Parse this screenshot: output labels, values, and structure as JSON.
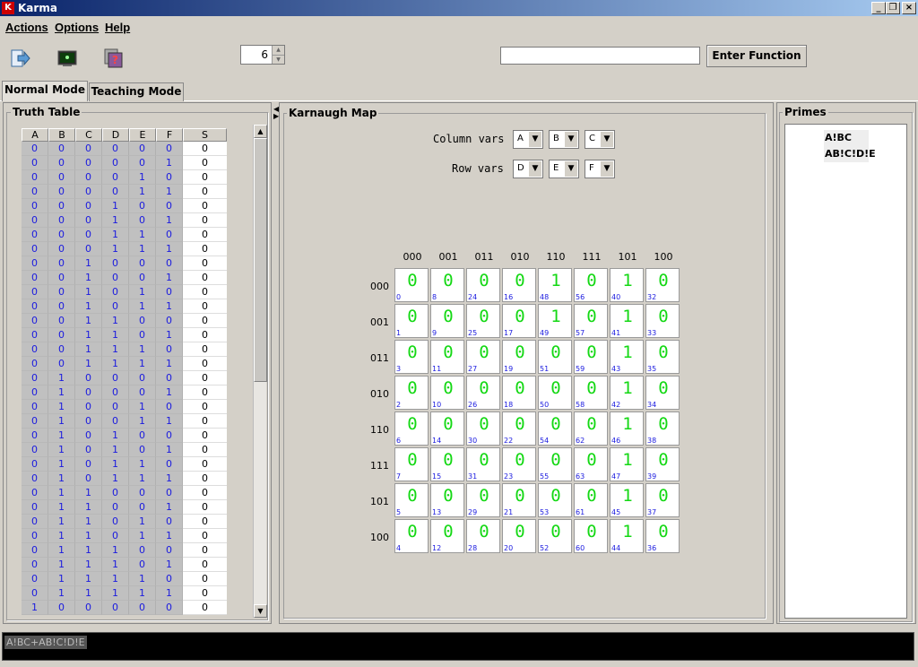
{
  "window": {
    "title": "Karma"
  },
  "menu": [
    "Actions",
    "Options",
    "Help"
  ],
  "toolbar": {
    "variable_count": "6",
    "function_input": "",
    "enter_button": "Enter Function"
  },
  "tabs": [
    "Normal Mode",
    "Teaching Mode"
  ],
  "truth_table": {
    "title": "Truth Table",
    "columns": [
      "A",
      "B",
      "C",
      "D",
      "E",
      "F",
      "S"
    ],
    "rows": [
      [
        "0",
        "0",
        "0",
        "0",
        "0",
        "0",
        "0"
      ],
      [
        "0",
        "0",
        "0",
        "0",
        "0",
        "1",
        "0"
      ],
      [
        "0",
        "0",
        "0",
        "0",
        "1",
        "0",
        "0"
      ],
      [
        "0",
        "0",
        "0",
        "0",
        "1",
        "1",
        "0"
      ],
      [
        "0",
        "0",
        "0",
        "1",
        "0",
        "0",
        "0"
      ],
      [
        "0",
        "0",
        "0",
        "1",
        "0",
        "1",
        "0"
      ],
      [
        "0",
        "0",
        "0",
        "1",
        "1",
        "0",
        "0"
      ],
      [
        "0",
        "0",
        "0",
        "1",
        "1",
        "1",
        "0"
      ],
      [
        "0",
        "0",
        "1",
        "0",
        "0",
        "0",
        "0"
      ],
      [
        "0",
        "0",
        "1",
        "0",
        "0",
        "1",
        "0"
      ],
      [
        "0",
        "0",
        "1",
        "0",
        "1",
        "0",
        "0"
      ],
      [
        "0",
        "0",
        "1",
        "0",
        "1",
        "1",
        "0"
      ],
      [
        "0",
        "0",
        "1",
        "1",
        "0",
        "0",
        "0"
      ],
      [
        "0",
        "0",
        "1",
        "1",
        "0",
        "1",
        "0"
      ],
      [
        "0",
        "0",
        "1",
        "1",
        "1",
        "0",
        "0"
      ],
      [
        "0",
        "0",
        "1",
        "1",
        "1",
        "1",
        "0"
      ],
      [
        "0",
        "1",
        "0",
        "0",
        "0",
        "0",
        "0"
      ],
      [
        "0",
        "1",
        "0",
        "0",
        "0",
        "1",
        "0"
      ],
      [
        "0",
        "1",
        "0",
        "0",
        "1",
        "0",
        "0"
      ],
      [
        "0",
        "1",
        "0",
        "0",
        "1",
        "1",
        "0"
      ],
      [
        "0",
        "1",
        "0",
        "1",
        "0",
        "0",
        "0"
      ],
      [
        "0",
        "1",
        "0",
        "1",
        "0",
        "1",
        "0"
      ],
      [
        "0",
        "1",
        "0",
        "1",
        "1",
        "0",
        "0"
      ],
      [
        "0",
        "1",
        "0",
        "1",
        "1",
        "1",
        "0"
      ],
      [
        "0",
        "1",
        "1",
        "0",
        "0",
        "0",
        "0"
      ],
      [
        "0",
        "1",
        "1",
        "0",
        "0",
        "1",
        "0"
      ],
      [
        "0",
        "1",
        "1",
        "0",
        "1",
        "0",
        "0"
      ],
      [
        "0",
        "1",
        "1",
        "0",
        "1",
        "1",
        "0"
      ],
      [
        "0",
        "1",
        "1",
        "1",
        "0",
        "0",
        "0"
      ],
      [
        "0",
        "1",
        "1",
        "1",
        "0",
        "1",
        "0"
      ],
      [
        "0",
        "1",
        "1",
        "1",
        "1",
        "0",
        "0"
      ],
      [
        "0",
        "1",
        "1",
        "1",
        "1",
        "1",
        "0"
      ],
      [
        "1",
        "0",
        "0",
        "0",
        "0",
        "0",
        "0"
      ]
    ]
  },
  "karnaugh": {
    "title": "Karnaugh Map",
    "column_vars_label": "Column vars",
    "row_vars_label": "Row vars",
    "column_vars": [
      "A",
      "B",
      "C"
    ],
    "row_vars": [
      "D",
      "E",
      "F"
    ],
    "col_headers": [
      "000",
      "001",
      "011",
      "010",
      "110",
      "111",
      "101",
      "100"
    ],
    "row_headers": [
      "000",
      "001",
      "011",
      "010",
      "110",
      "111",
      "101",
      "100"
    ],
    "values": [
      [
        "0",
        "0",
        "0",
        "0",
        "1",
        "0",
        "1",
        "0"
      ],
      [
        "0",
        "0",
        "0",
        "0",
        "1",
        "0",
        "1",
        "0"
      ],
      [
        "0",
        "0",
        "0",
        "0",
        "0",
        "0",
        "1",
        "0"
      ],
      [
        "0",
        "0",
        "0",
        "0",
        "0",
        "0",
        "1",
        "0"
      ],
      [
        "0",
        "0",
        "0",
        "0",
        "0",
        "0",
        "1",
        "0"
      ],
      [
        "0",
        "0",
        "0",
        "0",
        "0",
        "0",
        "1",
        "0"
      ],
      [
        "0",
        "0",
        "0",
        "0",
        "0",
        "0",
        "1",
        "0"
      ],
      [
        "0",
        "0",
        "0",
        "0",
        "0",
        "0",
        "1",
        "0"
      ]
    ],
    "indices": [
      [
        "0",
        "8",
        "24",
        "16",
        "48",
        "56",
        "40",
        "32"
      ],
      [
        "1",
        "9",
        "25",
        "17",
        "49",
        "57",
        "41",
        "33"
      ],
      [
        "3",
        "11",
        "27",
        "19",
        "51",
        "59",
        "43",
        "35"
      ],
      [
        "2",
        "10",
        "26",
        "18",
        "50",
        "58",
        "42",
        "34"
      ],
      [
        "6",
        "14",
        "30",
        "22",
        "54",
        "62",
        "46",
        "38"
      ],
      [
        "7",
        "15",
        "31",
        "23",
        "55",
        "63",
        "47",
        "39"
      ],
      [
        "5",
        "13",
        "29",
        "21",
        "53",
        "61",
        "45",
        "37"
      ],
      [
        "4",
        "12",
        "28",
        "20",
        "52",
        "60",
        "44",
        "36"
      ]
    ]
  },
  "primes": {
    "title": "Primes",
    "items": [
      "A!BC",
      "AB!C!D!E"
    ]
  },
  "status": {
    "expression": "A!BC+AB!C!D!E"
  }
}
